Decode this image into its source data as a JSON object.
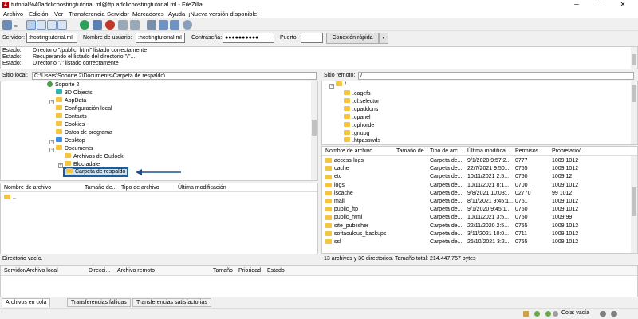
{
  "window": {
    "title": "tutorial%40adclichostingtutorial.ml@ftp.adclichostingtutorial.ml - FileZilla",
    "logo_glyph": "Z"
  },
  "menu": [
    "Archivo",
    "Edición",
    "Ver",
    "Transferencia",
    "Servidor",
    "Marcadores",
    "Ayuda",
    "¡Nueva versión disponible!"
  ],
  "toolbar_icons": [
    "site-manager-icon",
    "toggle-log-icon",
    "toggle-tree-icon",
    "toggle-remote-tree-icon",
    "toggle-queue-icon",
    "refresh-icon",
    "process-queue-icon",
    "cancel-icon",
    "disconnect-icon",
    "reconnect-icon",
    "filter-icon",
    "compare-icon",
    "sync-browse-icon",
    "search-icon"
  ],
  "quickconnect": {
    "server_label": "Servidor:",
    "server_value": ":hostingtutorial.ml",
    "user_label": "Nombre de usuario:",
    "user_value": ":hostingtutorial.ml",
    "pass_label": "Contraseña:",
    "pass_value": "●●●●●●●●●●",
    "port_label": "Puerto:",
    "port_value": "",
    "connect_label": "Conexión rápida",
    "dropdown_glyph": "▼"
  },
  "log": [
    {
      "label": "Estado:",
      "text": "Directorio \"/public_html\" listado correctamente"
    },
    {
      "label": "Estado:",
      "text": "Recuperando el listado del directorio \"/\"..."
    },
    {
      "label": "Estado:",
      "text": "Directorio \"/\" listado correctamente"
    }
  ],
  "local": {
    "site_label": "Sitio local:",
    "path": "C:\\Users\\Soporte 2\\Documents\\Carpeta de respaldo\\",
    "tree": [
      {
        "label": "Soporte 2",
        "kind": "user"
      },
      {
        "label": "3D Objects",
        "kind": "teal"
      },
      {
        "label": "AppData",
        "kind": "folder"
      },
      {
        "label": "Configuración local",
        "kind": "folder"
      },
      {
        "label": "Contacts",
        "kind": "folder"
      },
      {
        "label": "Cookies",
        "kind": "folder"
      },
      {
        "label": "Datos de programa",
        "kind": "folder"
      },
      {
        "label": "Desktop",
        "kind": "blue"
      },
      {
        "label": "Documents",
        "kind": "folder"
      },
      {
        "label": "Archivos de Outlook",
        "kind": "folder"
      },
      {
        "label": "Bloc adafe",
        "kind": "folder"
      },
      {
        "label": "Carpeta de respaldo",
        "kind": "folder"
      }
    ],
    "headers": [
      "Nombre de archivo",
      "Tamaño de...",
      "Tipo de archivo",
      "Última modificación"
    ],
    "files": [
      ".."
    ],
    "status": "Directorio vacío."
  },
  "remote": {
    "site_label": "Sitio remoto:",
    "path": "/",
    "tree_root": "/",
    "tree": [
      ".cagefs",
      ".cl.selector",
      ".cpaddons",
      ".cpanel",
      ".cphorde",
      ".gnupg",
      ".htpasswds"
    ],
    "headers": [
      "Nombre de archivo",
      "Tamaño de...",
      "Tipo de arc...",
      "Última modifica...",
      "Permisos",
      "Propietario/..."
    ],
    "files": [
      {
        "name": "access-logs",
        "type": "Carpeta de...",
        "modified": "9/1/2020 9:57:2...",
        "perms": "0777",
        "owner": "1009 1012"
      },
      {
        "name": "cache",
        "type": "Carpeta de...",
        "modified": "22/7/2021 9:50:...",
        "perms": "0755",
        "owner": "1009 1012"
      },
      {
        "name": "etc",
        "type": "Carpeta de...",
        "modified": "10/11/2021 2:5...",
        "perms": "0750",
        "owner": "1009 12"
      },
      {
        "name": "logs",
        "type": "Carpeta de...",
        "modified": "10/11/2021 8:1...",
        "perms": "0700",
        "owner": "1009 1012"
      },
      {
        "name": "lscache",
        "type": "Carpeta de...",
        "modified": "9/8/2021 10:03:...",
        "perms": "02770",
        "owner": "99 1012"
      },
      {
        "name": "mail",
        "type": "Carpeta de...",
        "modified": "8/11/2021 9:45:1...",
        "perms": "0751",
        "owner": "1009 1012"
      },
      {
        "name": "public_ftp",
        "type": "Carpeta de...",
        "modified": "9/1/2020 9:45:1...",
        "perms": "0750",
        "owner": "1009 1012"
      },
      {
        "name": "public_html",
        "type": "Carpeta de...",
        "modified": "10/11/2021 3:5...",
        "perms": "0750",
        "owner": "1009 99"
      },
      {
        "name": "site_publisher",
        "type": "Carpeta de...",
        "modified": "22/11/2020 2:5...",
        "perms": "0755",
        "owner": "1009 1012"
      },
      {
        "name": "softaculous_backups",
        "type": "Carpeta de...",
        "modified": "3/11/2021 10:0...",
        "perms": "0711",
        "owner": "1009 1012"
      },
      {
        "name": "ssl",
        "type": "Carpeta de...",
        "modified": "26/10/2021 3:2...",
        "perms": "0755",
        "owner": "1009 1012"
      }
    ],
    "status": "13 archivos y 30 directorios. Tamaño total: 214.447.757 bytes"
  },
  "queue": {
    "headers": [
      "Servidor/Archivo local",
      "Direcci...",
      "Archivo remoto",
      "Tamaño",
      "Prioridad",
      "Estado"
    ]
  },
  "tabs": [
    "Archivos en cola",
    "Transferencias fallidas",
    "Transferencias satisfactorias"
  ],
  "statusbar": {
    "queue": "Cola: vacía"
  },
  "colors": {
    "highlight_border": "#1e5e9e",
    "arrow": "#1e4f8c",
    "folder": "#f5c542",
    "connect_button": "#e1e1e1"
  }
}
